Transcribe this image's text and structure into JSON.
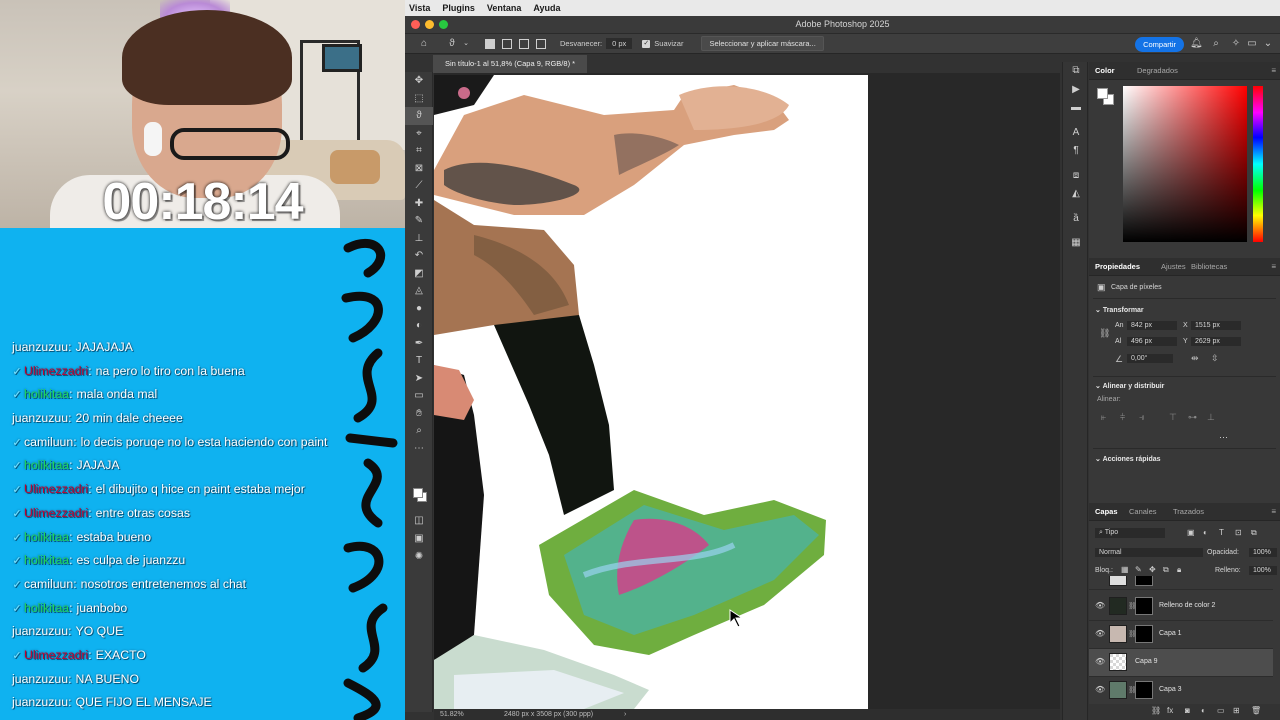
{
  "stream": {
    "timer": "00:18:14",
    "chat": [
      {
        "user": "juanzuzuu",
        "badge": false,
        "user_color": "#ffffff",
        "message": "JAJAJAJA"
      },
      {
        "user": "Ulimezzadri",
        "badge": true,
        "user_color": "#c4002f",
        "message": "na pero lo tiro con la buena"
      },
      {
        "user": "holikitaa",
        "badge": true,
        "user_color": "#1fd35b",
        "message": "mala onda mal"
      },
      {
        "user": "juanzuzuu",
        "badge": false,
        "user_color": "#ffffff",
        "message": "20 min dale cheeee"
      },
      {
        "user": "camiluun",
        "badge": true,
        "user_color": "#ffffff",
        "message": "lo decis poruqe no lo esta haciendo con paint"
      },
      {
        "user": "holikitaa",
        "badge": true,
        "user_color": "#1fd35b",
        "message": "JAJAJA"
      },
      {
        "user": "Ulimezzadri",
        "badge": true,
        "user_color": "#c4002f",
        "message": "el dibujito q hice cn paint estaba mejor"
      },
      {
        "user": "Ulimezzadri",
        "badge": true,
        "user_color": "#c4002f",
        "message": "entre otras cosas"
      },
      {
        "user": "holikitaa",
        "badge": true,
        "user_color": "#1fd35b",
        "message": "estaba bueno"
      },
      {
        "user": "holikitaa",
        "badge": true,
        "user_color": "#1fd35b",
        "message": "es culpa de juanzzu"
      },
      {
        "user": "camiluun",
        "badge": true,
        "user_color": "#ffffff",
        "message": "nosotros entretenemos al chat"
      },
      {
        "user": "holikitaa",
        "badge": true,
        "user_color": "#1fd35b",
        "message": "juanbobo"
      },
      {
        "user": "juanzuzuu",
        "badge": false,
        "user_color": "#ffffff",
        "message": "YO QUE"
      },
      {
        "user": "Ulimezzadri",
        "badge": true,
        "user_color": "#c4002f",
        "message": "EXACTO"
      },
      {
        "user": "juanzuzuu",
        "badge": false,
        "user_color": "#ffffff",
        "message": "NA BUENO"
      },
      {
        "user": "juanzuzuu",
        "badge": false,
        "user_color": "#ffffff",
        "message": "QUE FIJO EL MENSAJE"
      }
    ]
  },
  "menubar": {
    "items": [
      "Vista",
      "Plugins",
      "Ventana",
      "Ayuda"
    ]
  },
  "app": {
    "title": "Adobe Photoshop 2025",
    "share_label": "Compartir"
  },
  "options": {
    "feather_label": "Desvanecer:",
    "feather_value": "0 px",
    "smooth_label": "Suavizar",
    "mask_button": "Seleccionar y aplicar máscara..."
  },
  "document": {
    "tab": "Sin título-1 al 51,8% (Capa 9, RGB/8) *",
    "zoom": "51.82%",
    "info": "2480 px x 3508 px (300 ppp)"
  },
  "color_panel": {
    "tabs": [
      "Color",
      "Degradados"
    ]
  },
  "properties": {
    "tabs": [
      "Propiedades",
      "Ajustes",
      "Bibliotecas"
    ],
    "layer_type": "Capa de píxeles",
    "transform_label": "Transformar",
    "w_label": "An",
    "w_value": "842 px",
    "h_label": "Al",
    "h_value": "496 px",
    "x_label": "X",
    "x_value": "1515 px",
    "y_label": "Y",
    "y_value": "2629 px",
    "angle_value": "0,00°",
    "align_label": "Alinear y distribuir",
    "align_sub": "Alinear:",
    "quick_actions": "Acciones rápidas"
  },
  "layers_panel": {
    "tabs": [
      "Capas",
      "Canales",
      "Trazados"
    ],
    "filter": "Tipo",
    "blend_mode": "Normal",
    "opacity_label": "Opacidad:",
    "opacity_value": "100%",
    "lock_label": "Bloq.:",
    "fill_label": "Relleno:",
    "fill_value": "100%",
    "layers": [
      {
        "name": "Relleno de color 2",
        "selected": false
      },
      {
        "name": "Capa 1",
        "selected": false
      },
      {
        "name": "Capa 9",
        "selected": true
      },
      {
        "name": "Capa 3",
        "selected": false
      }
    ]
  }
}
